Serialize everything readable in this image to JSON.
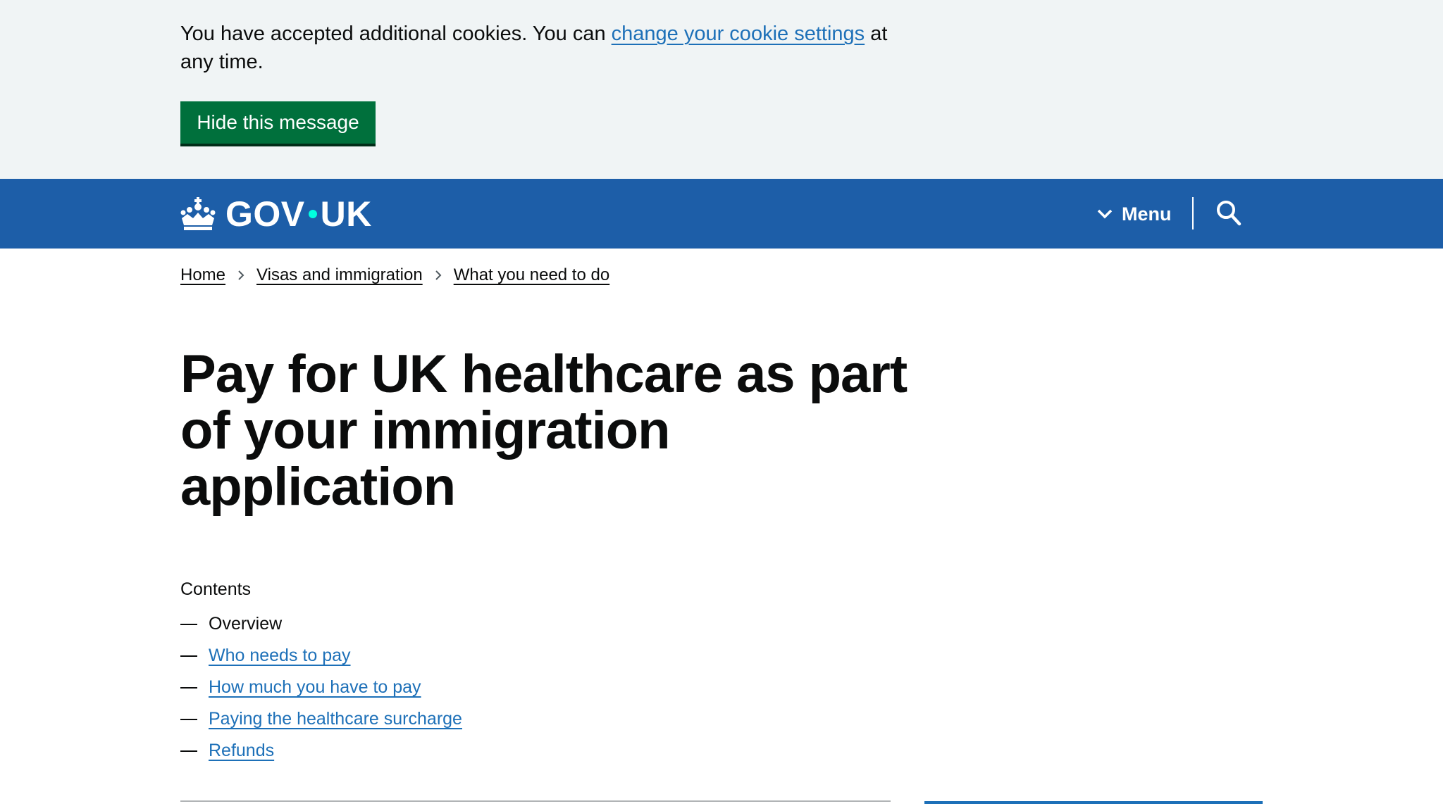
{
  "cookie_banner": {
    "message_before": "You have accepted additional cookies. You can ",
    "link_text": "change your cookie settings",
    "message_after": " at any time.",
    "hide_button": "Hide this message"
  },
  "header": {
    "logo_left": "GOV",
    "logo_right": "UK",
    "menu_label": "Menu"
  },
  "breadcrumbs": [
    "Home",
    "Visas and immigration",
    "What you need to do"
  ],
  "page": {
    "title": "Pay for UK healthcare as part of your immigration application"
  },
  "contents": {
    "heading": "Contents",
    "items": [
      {
        "label": "Overview",
        "current": true
      },
      {
        "label": "Who needs to pay",
        "current": false
      },
      {
        "label": "How much you have to pay",
        "current": false
      },
      {
        "label": "Paying the healthcare surcharge",
        "current": false
      },
      {
        "label": "Refunds",
        "current": false
      }
    ]
  },
  "colors": {
    "header_blue": "#1d5ea8",
    "link_blue": "#1d70b8",
    "button_green": "#00703c",
    "banner_bg": "#f0f4f5",
    "logo_dot": "#00ffe0"
  }
}
